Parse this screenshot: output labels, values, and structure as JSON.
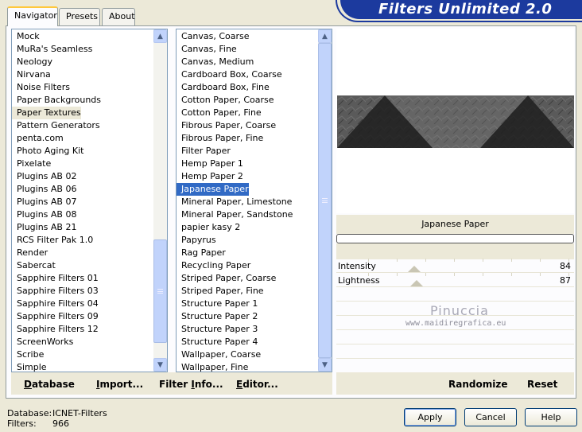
{
  "tabs": [
    {
      "label": "Navigator",
      "active": true
    },
    {
      "label": "Presets",
      "active": false
    },
    {
      "label": "About",
      "active": false
    }
  ],
  "app_title": "Filters Unlimited 2.0",
  "categories": [
    "Mock",
    "MuRa's Seamless",
    "Neology",
    "Nirvana",
    "Noise Filters",
    "Paper Backgrounds",
    "Paper Textures",
    "Pattern Generators",
    "penta.com",
    "Photo Aging Kit",
    "Pixelate",
    "Plugins AB 02",
    "Plugins AB 06",
    "Plugins AB 07",
    "Plugins AB 08",
    "Plugins AB 21",
    "RCS Filter Pak 1.0",
    "Render",
    "Sabercat",
    "Sapphire Filters 01",
    "Sapphire Filters 03",
    "Sapphire Filters 04",
    "Sapphire Filters 09",
    "Sapphire Filters 12",
    "ScreenWorks",
    "Scribe",
    "Simple"
  ],
  "selected_category": "Paper Textures",
  "filters": [
    "Canvas, Coarse",
    "Canvas, Fine",
    "Canvas, Medium",
    "Cardboard Box, Coarse",
    "Cardboard Box, Fine",
    "Cotton Paper, Coarse",
    "Cotton Paper, Fine",
    "Fibrous Paper, Coarse",
    "Fibrous Paper, Fine",
    "Filter Paper",
    "Hemp Paper 1",
    "Hemp Paper 2",
    "Japanese Paper",
    "Mineral Paper, Limestone",
    "Mineral Paper, Sandstone",
    "papier kasy 2",
    "Papyrus",
    "Rag Paper",
    "Recycling Paper",
    "Striped Paper, Coarse",
    "Striped Paper, Fine",
    "Structure Paper 1",
    "Structure Paper 2",
    "Structure Paper 3",
    "Structure Paper 4",
    "Wallpaper, Coarse",
    "Wallpaper, Fine"
  ],
  "selected_filter": "Japanese Paper",
  "left_buttons": [
    {
      "label": "Database",
      "ul": "D"
    },
    {
      "label": "Import...",
      "ul": "I"
    },
    {
      "label": "Filter Info...",
      "ul": "I"
    },
    {
      "label": "Editor...",
      "ul": "E"
    }
  ],
  "current_filter_name": "Japanese Paper",
  "params": [
    {
      "label": "Intensity",
      "value": "84",
      "level": 84
    },
    {
      "label": "Lightness",
      "value": "87",
      "level": 87
    }
  ],
  "watermark": {
    "name": "Pinuccia",
    "url": "www.maidiregrafica.eu"
  },
  "right_buttons": {
    "randomize": "Randomize",
    "reset": "Reset"
  },
  "info": {
    "database_label": "Database:",
    "database_value": "ICNET-Filters",
    "filters_label": "Filters:",
    "filters_value": "966"
  },
  "dialog_buttons": {
    "apply": "Apply",
    "cancel": "Cancel",
    "help": "Help"
  },
  "colors": {
    "selection": "#316ac5",
    "banner": "#1c3a9e",
    "background": "#ece9d8"
  }
}
